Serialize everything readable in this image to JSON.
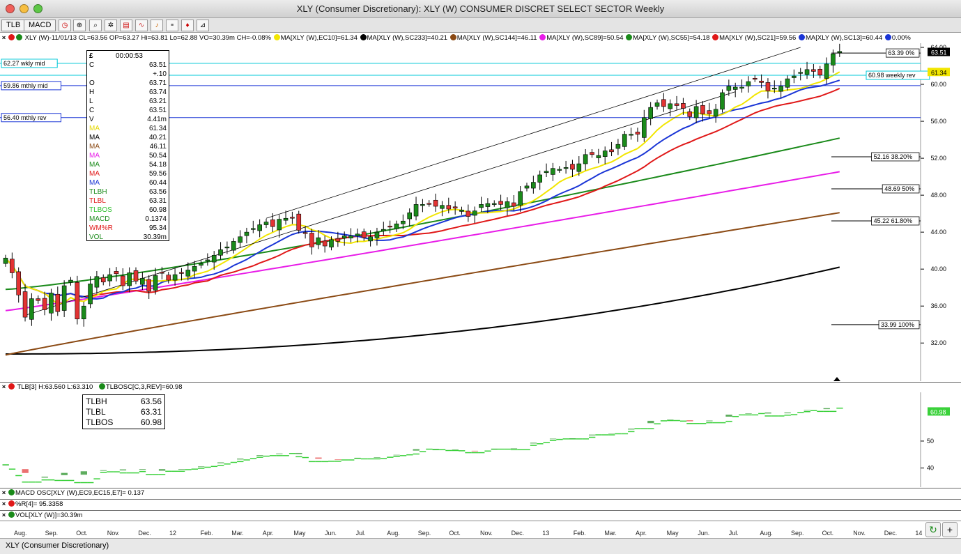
{
  "window": {
    "title": "XLY (Consumer Discretionary): XLY (W) CONSUMER DISCRET SELECT SECTOR Weekly",
    "status": "XLY (Consumer Discretionary)"
  },
  "toolbar": {
    "tabs": [
      "TLB",
      "MACD"
    ]
  },
  "legend": {
    "quote": "XLY (W)-11/01/13 CL=63.56 OP=63.27 Hi=63.81 Lo=62.88 VO=30.39m CH=-0.08%",
    "ma10": "MA[XLY (W),EC10]=61.34",
    "ma233": "MA[XLY (W),SC233]=40.21",
    "ma144": "MA[XLY (W),SC144]=46.11",
    "ma89": "MA[XLY (W),SC89]=50.54",
    "ma55": "MA[XLY (W),SC55]=54.18",
    "ma21": "MA[XLY (W),SC21]=59.56",
    "ma13": "MA[XLY (W),SC13]=60.44",
    "pct": "0.00%"
  },
  "colors": {
    "up": "#1a8a1a",
    "down": "#e23333",
    "ma10": "#f2e600",
    "ma13": "#1a35d6",
    "ma21": "#e01818",
    "ma55": "#1a8a1a",
    "ma89": "#e81ce8",
    "ma144": "#8b4a14",
    "ma233": "#000000",
    "mid": "#00c8d8",
    "rev": "#1a35d6"
  },
  "levels": {
    "wkly_mid": "62.27 wkly mid",
    "mthly_mid": "59.86 mthly mid",
    "mthly_rev": "56.40 mthly rev",
    "weekly_rev": "60.98 weekly rev",
    "fib_0": "63.39 0%",
    "fib_382": "52.16 38.20%",
    "fib_50": "48.69 50%",
    "fib_618": "45.22 61.80%",
    "fib_100": "33.99 100%",
    "last_price": "63.51",
    "ma10_tag": "61.34"
  },
  "databox": {
    "time": "00:00:53",
    "rows": [
      {
        "label": "C",
        "value": "63.51",
        "color": "#000000"
      },
      {
        "label": "",
        "value": "+.10",
        "color": "#000000"
      },
      {
        "label": "O",
        "value": "63.71",
        "color": "#000000"
      },
      {
        "label": "H",
        "value": "63.74",
        "color": "#000000"
      },
      {
        "label": "L",
        "value": "63.21",
        "color": "#000000"
      },
      {
        "label": "C",
        "value": "63.51",
        "color": "#000000"
      },
      {
        "label": "V",
        "value": "4.41m",
        "color": "#000000"
      },
      {
        "label": "MA",
        "value": "61.34",
        "color": "#e6d800"
      },
      {
        "label": "MA",
        "value": "40.21",
        "color": "#000000"
      },
      {
        "label": "MA",
        "value": "46.11",
        "color": "#8b4a14"
      },
      {
        "label": "MA",
        "value": "50.54",
        "color": "#e81ce8"
      },
      {
        "label": "MA",
        "value": "54.18",
        "color": "#1a8a1a"
      },
      {
        "label": "MA",
        "value": "59.56",
        "color": "#e01818"
      },
      {
        "label": "MA",
        "value": "60.44",
        "color": "#1a35d6"
      },
      {
        "label": "TLBH",
        "value": "63.56",
        "color": "#1a8a1a"
      },
      {
        "label": "TLBL",
        "value": "63.31",
        "color": "#e01818"
      },
      {
        "label": "TLBOS",
        "value": "60.98",
        "color": "#30c030"
      },
      {
        "label": "MACD",
        "value": "0.1374",
        "color": "#1a8a1a"
      },
      {
        "label": "WM%R",
        "value": "95.34",
        "color": "#e01818"
      },
      {
        "label": "VOL",
        "value": "30.39m",
        "color": "#1a8a1a"
      }
    ]
  },
  "tlb": {
    "header": "TLB[3] H:63.560 L:63.310",
    "header2": "TLBOSC[C,3,REV]=60.98",
    "box": [
      {
        "label": "TLBH",
        "value": "63.56"
      },
      {
        "label": "TLBL",
        "value": "63.31"
      },
      {
        "label": "TLBOS",
        "value": "60.98"
      }
    ],
    "tag": "60.98",
    "axis_ticks": [
      "50",
      "40"
    ]
  },
  "stubs": {
    "macd": "MACD OSC[XLY (W),EC9,EC15,E7]= 0.137",
    "wmr": "%R[4]= 95.3358",
    "vol": "VOL[XLY (W)]=30.39m"
  },
  "x_axis": {
    "ticks": [
      "Aug.",
      "Sep.",
      "Oct.",
      "Nov.",
      "Dec.",
      "12",
      "Feb.",
      "Mar.",
      "Apr.",
      "May",
      "Jun.",
      "Jul.",
      "Aug.",
      "Sep.",
      "Oct.",
      "Nov.",
      "Dec.",
      "13",
      "Feb.",
      "Mar.",
      "Apr.",
      "May",
      "Jun.",
      "Jul.",
      "Aug.",
      "Sep.",
      "Oct.",
      "Nov.",
      "Dec.",
      "14"
    ]
  },
  "chart_data": {
    "type": "candlestick",
    "symbol": "XLY",
    "timeframe": "Weekly",
    "y_range": [
      29,
      64
    ],
    "y_ticks": [
      64,
      60,
      56,
      52,
      48,
      44,
      40,
      36,
      32
    ],
    "x_range_weeks": [
      -1,
      128
    ],
    "closes": [
      41.2,
      39.6,
      37.2,
      34.8,
      36.8,
      36.6,
      35.6,
      37.4,
      35.4,
      38.2,
      38.8,
      34.6,
      36.0,
      38.4,
      39.2,
      38.6,
      39.4,
      39.5,
      38.2,
      39.6,
      38.7,
      39.0,
      37.6,
      39.3,
      39.6,
      38.8,
      39.4,
      39.6,
      39.9,
      40.3,
      40.6,
      41.0,
      41.5,
      42.1,
      42.4,
      43.0,
      43.5,
      44.0,
      44.4,
      44.8,
      45.1,
      44.6,
      45.4,
      45.5,
      45.6,
      44.2,
      43.9,
      42.4,
      43.4,
      42.5,
      43.2,
      43.0,
      43.6,
      43.6,
      43.8,
      43.4,
      43.5,
      44.0,
      44.3,
      44.6,
      44.9,
      45.2,
      46.1,
      47.0,
      47.0,
      47.1,
      46.8,
      46.9,
      46.5,
      46.6,
      46.4,
      45.7,
      46.3,
      47.0,
      47.1,
      47.1,
      47.0,
      47.3,
      46.8,
      48.4,
      49.0,
      49.4,
      50.2,
      50.6,
      50.9,
      50.8,
      51.0,
      50.8,
      51.4,
      52.4,
      52.4,
      52.3,
      52.8,
      52.7,
      53.5,
      54.6,
      54.6,
      54.6,
      56.4,
      57.5,
      58.0,
      57.6,
      57.9,
      57.7,
      57.4,
      56.5,
      57.6,
      56.8,
      56.8,
      57.3,
      59.1,
      59.8,
      59.7,
      59.7,
      60.3,
      60.6,
      60.2,
      59.3,
      59.6,
      59.8,
      60.6,
      60.9,
      61.3,
      61.6,
      61.4,
      61.0,
      62.2,
      63.3,
      63.56
    ],
    "opens_tlb_lines": {
      "tlbh": 63.56,
      "tlbl": 63.31,
      "tlbos": 60.98
    },
    "moving_averages": {
      "EC10": 61.34,
      "SC13": 60.44,
      "SC21": 59.56,
      "SC55": 54.18,
      "SC89": 50.54,
      "SC144": 46.11,
      "SC233": 40.21
    },
    "horizontal_levels": [
      {
        "label": "62.27 wkly mid",
        "value": 62.27
      },
      {
        "label": "60.98 weekly rev",
        "value": 60.98
      },
      {
        "label": "59.86 mthly mid",
        "value": 59.86
      },
      {
        "label": "56.40 mthly rev",
        "value": 56.4
      }
    ],
    "fib_levels": [
      {
        "label": "63.39 0%",
        "value": 63.39
      },
      {
        "label": "52.16 38.20%",
        "value": 52.16
      },
      {
        "label": "48.69 50%",
        "value": 48.69
      },
      {
        "label": "45.22 61.80%",
        "value": 45.22
      },
      {
        "label": "33.99 100%",
        "value": 33.99
      }
    ],
    "trend_channel": {
      "lower": [
        [
          3,
          35.0
        ],
        [
          112,
          59.2
        ]
      ],
      "upper": [
        [
          40,
          45.5
        ],
        [
          122,
          64.0
        ]
      ]
    }
  }
}
